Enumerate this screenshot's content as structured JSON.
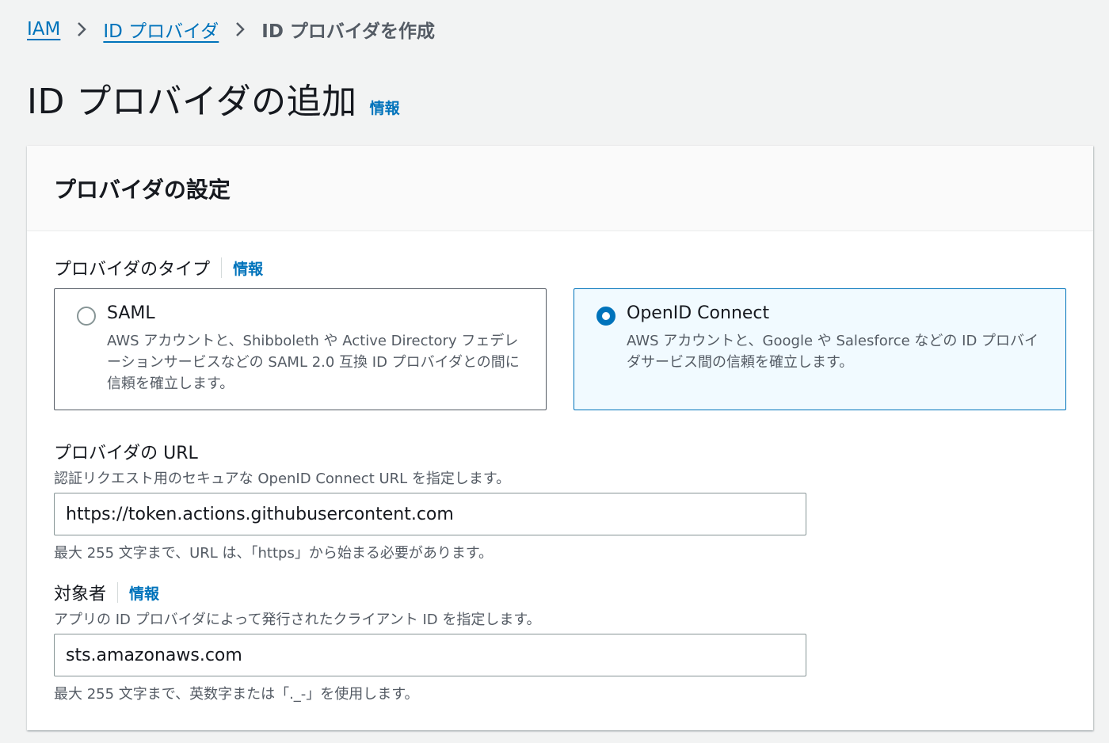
{
  "breadcrumb": {
    "items": [
      {
        "label": "IAM"
      },
      {
        "label": "ID プロバイダ"
      }
    ],
    "current": "ID プロバイダを作成"
  },
  "page": {
    "title": "ID プロバイダの追加",
    "info": "情報"
  },
  "panel": {
    "title": "プロバイダの設定",
    "provider_type": {
      "label": "プロバイダのタイプ",
      "info": "情報",
      "options": [
        {
          "title": "SAML",
          "description": "AWS アカウントと、Shibboleth や Active Directory フェデレーションサービスなどの SAML 2.0 互換 ID プロバイダとの間に信頼を確立します。",
          "selected": false
        },
        {
          "title": "OpenID Connect",
          "description": "AWS アカウントと、Google や Salesforce などの ID プロバイダサービス間の信頼を確立します。",
          "selected": true
        }
      ]
    },
    "provider_url": {
      "label": "プロバイダの URL",
      "description": "認証リクエスト用のセキュアな OpenID Connect URL を指定します。",
      "value": "https://token.actions.githubusercontent.com",
      "hint": "最大 255 文字まで、URL は、「https」から始まる必要があります。"
    },
    "audience": {
      "label": "対象者",
      "info": "情報",
      "description": "アプリの ID プロバイダによって発行されたクライアント ID を指定します。",
      "value": "sts.amazonaws.com",
      "hint": "最大 255 文字まで、英数字または「._-」を使用します。"
    }
  },
  "colors": {
    "link": "#0073bb",
    "background": "#f2f3f3",
    "selected_card_bg": "#f1faff",
    "secondary_text": "#545b64"
  }
}
